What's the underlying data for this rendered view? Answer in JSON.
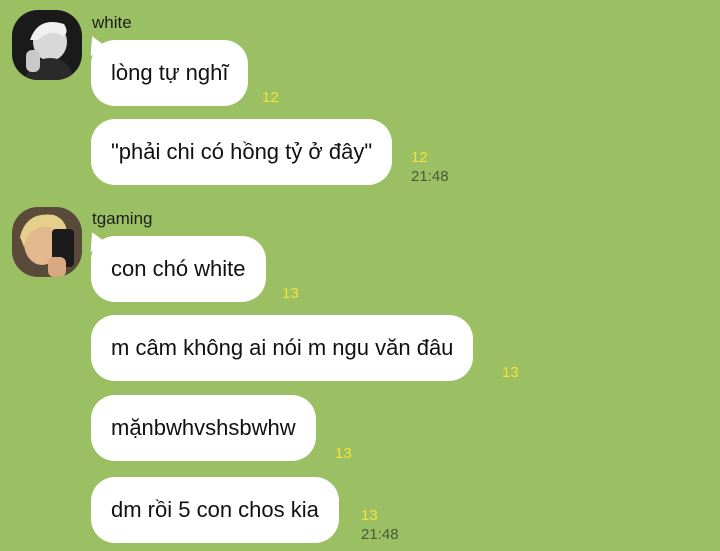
{
  "groups": [
    {
      "sender": "white",
      "messages": [
        {
          "text": "lòng tự nghĩ",
          "read": "12",
          "time": ""
        },
        {
          "text": "\"phải chi có hồng tỷ ở đây\"",
          "read": "12",
          "time": "21:48"
        }
      ]
    },
    {
      "sender": "tgaming",
      "messages": [
        {
          "text": "con chó white",
          "read": "13",
          "time": ""
        },
        {
          "text": "m câm không ai nói m ngu văn đâu",
          "read": "13",
          "time": ""
        },
        {
          "text": "mặnbwhvshsbwhw",
          "read": "13",
          "time": ""
        },
        {
          "text": "dm rồi 5 con chos kia",
          "read": "13",
          "time": "21:48"
        }
      ]
    }
  ],
  "colors": {
    "background": "#9bc063",
    "bubble": "#ffffff",
    "read_count": "#f2e33a"
  }
}
